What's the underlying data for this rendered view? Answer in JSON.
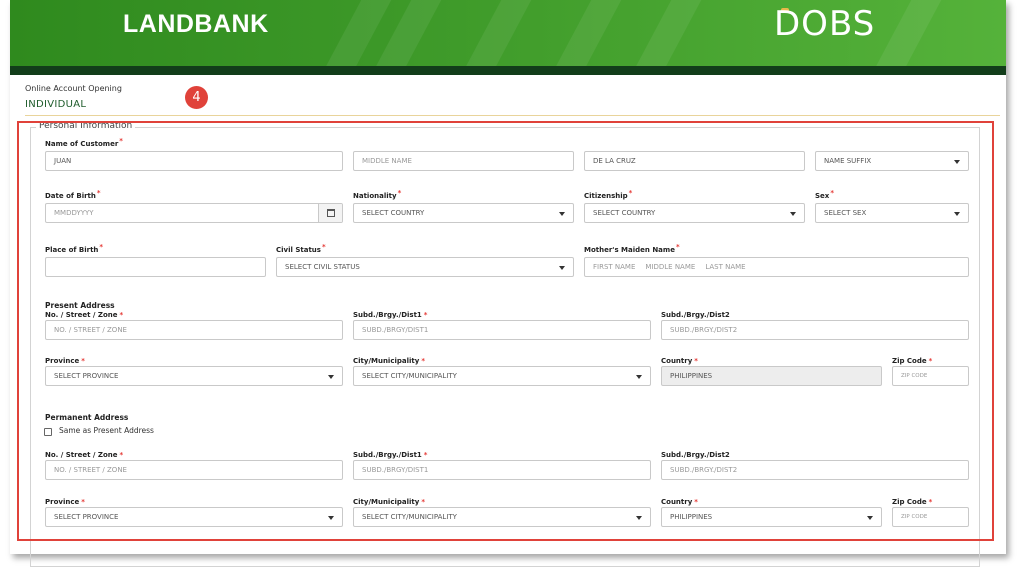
{
  "header": {
    "brand": "LANDBANK",
    "app_logo": "DOBS",
    "brand_color": "#3f9b2a"
  },
  "breadcrumb": "Online Account Opening",
  "page_title": "INDIVIDUAL",
  "step_badge": "4",
  "section_title": "Personal Information",
  "name": {
    "label": "Name of Customer",
    "first": "JUAN",
    "middle_placeholder": "MIDDLE NAME",
    "last": "DE LA CRUZ",
    "suffix": "NAME SUFFIX"
  },
  "dob": {
    "label": "Date of Birth",
    "placeholder": "MMDDYYYY"
  },
  "nationality": {
    "label": "Nationality",
    "value": "SELECT COUNTRY"
  },
  "citizenship": {
    "label": "Citizenship",
    "value": "SELECT COUNTRY"
  },
  "sex": {
    "label": "Sex",
    "value": "SELECT SEX"
  },
  "pob": {
    "label": "Place of Birth",
    "value": ""
  },
  "civil": {
    "label": "Civil Status",
    "value": "SELECT CIVIL STATUS"
  },
  "mother": {
    "label": "Mother's Maiden Name",
    "first": "FIRST NAME",
    "middle": "MIDDLE NAME",
    "last": "LAST NAME"
  },
  "present": {
    "title": "Present Address",
    "street_label": "No. / Street / Zone",
    "street_placeholder": "NO. / STREET / ZONE",
    "subd1_label": "Subd./Brgy./Dist1",
    "subd1_placeholder": "SUBD./BRGY/DIST1",
    "subd2_label": "Subd./Brgy./Dist2",
    "subd2_placeholder": "SUBD./BRGY./DIST2",
    "province_label": "Province",
    "province_value": "SELECT PROVINCE",
    "city_label": "City/Municipality",
    "city_value": "SELECT CITY/MUNICIPALITY",
    "country_label": "Country",
    "country_value": "PHILIPPINES",
    "zip_label": "Zip Code",
    "zip_placeholder": "ZIP CODE"
  },
  "permanent": {
    "title": "Permanent Address",
    "same_label": "Same as Present Address",
    "street_label": "No. / Street / Zone",
    "street_placeholder": "NO. / STREET / ZONE",
    "subd1_label": "Subd./Brgy./Dist1",
    "subd1_placeholder": "SUBD./BRGY/DIST1",
    "subd2_label": "Subd./Brgy./Dist2",
    "subd2_placeholder": "SUBD./BRGY./DIST2",
    "province_label": "Province",
    "province_value": "SELECT PROVINCE",
    "city_label": "City/Municipality",
    "city_value": "SELECT CITY/MUNICIPALITY",
    "country_label": "Country",
    "country_value": "PHILIPPINES",
    "zip_label": "Zip Code",
    "zip_placeholder": "ZIP CODE"
  }
}
